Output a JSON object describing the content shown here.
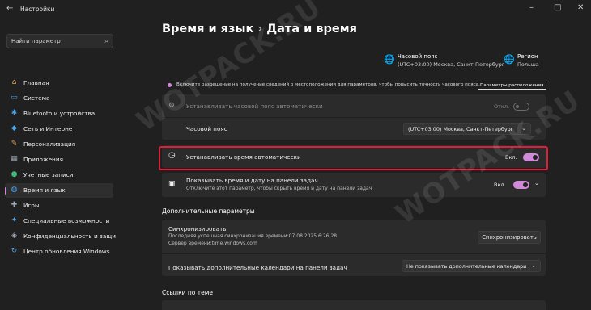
{
  "window": {
    "title": "Настройки",
    "back_icon": "back-arrow-icon",
    "controls": [
      "minimize-icon",
      "maximize-icon",
      "close-icon"
    ]
  },
  "sidebar": {
    "search_placeholder": "Найти параметр",
    "items": [
      {
        "label": "Главная",
        "icon": "home-icon",
        "color": "#e0a050"
      },
      {
        "label": "Система",
        "icon": "monitor-icon",
        "color": "#4aa3e8"
      },
      {
        "label": "Bluetooth и устройства",
        "icon": "bluetooth-icon",
        "color": "#4aa3e8"
      },
      {
        "label": "Сеть и Интернет",
        "icon": "wifi-icon",
        "color": "#4aa3e8"
      },
      {
        "label": "Персонализация",
        "icon": "brush-icon",
        "color": "#e0a050"
      },
      {
        "label": "Приложения",
        "icon": "apps-icon",
        "color": "#9ea7b5"
      },
      {
        "label": "Учетные записи",
        "icon": "user-icon",
        "color": "#3fb87a"
      },
      {
        "label": "Время и язык",
        "icon": "globe-clock-icon",
        "color": "#4aa3e8",
        "active": true
      },
      {
        "label": "Игры",
        "icon": "gamepad-icon",
        "color": "#9ea7b5"
      },
      {
        "label": "Специальные возможности",
        "icon": "accessibility-icon",
        "color": "#4aa3e8"
      },
      {
        "label": "Конфиденциальность и защи",
        "icon": "shield-icon",
        "color": "#9ea7b5"
      },
      {
        "label": "Центр обновления Windows",
        "icon": "update-icon",
        "color": "#4aa3e8"
      }
    ]
  },
  "header": {
    "crumb_parent": "Время и язык",
    "crumb_sep": "›",
    "crumb_current": "Дата и время"
  },
  "summary": {
    "timezone_title": "Часовой пояс",
    "timezone_value": "(UTC+03:00) Москва, Санкт-Петербург",
    "region_title": "Регион",
    "region_value": "Польша"
  },
  "notice": {
    "text": "Включите разрешение на получение сведений о местоположении для параметров, чтобы повысить точность часового пояса.",
    "link": "Параметры расположения"
  },
  "settings": {
    "auto_tz": {
      "label": "Устанавливать часовой пояс автоматически",
      "state": "Откл."
    },
    "timezone": {
      "label": "Часовой пояс",
      "value": "(UTC+03:00) Москва, Санкт-Петербург"
    },
    "auto_time": {
      "label": "Устанавливать время автоматически",
      "state": "Вкл."
    },
    "show_tray": {
      "label": "Показывать время и дату на панели задач",
      "sub": "Отключите этот параметр, чтобы скрыть время и дату на панели задач",
      "state": "Вкл."
    }
  },
  "additional": {
    "title": "Дополнительные параметры",
    "sync_title": "Синхронизировать",
    "sync_last": "Последняя успешная синхронизация времени:07.08.2025 6:26:28",
    "sync_server": "Сервер времени:time.windows.com",
    "sync_button": "Синхронизировать",
    "calendars_label": "Показывать дополнительные календари на панели задач",
    "calendars_value": "Не показывать дополнительные календари"
  },
  "related": {
    "title": "Ссылки по теме"
  },
  "watermark": "WOTPACK.RU",
  "colors": {
    "accent": "#d08ad8",
    "highlight": "#e21d3a",
    "background": "#202020",
    "card": "#2b2b2b"
  }
}
